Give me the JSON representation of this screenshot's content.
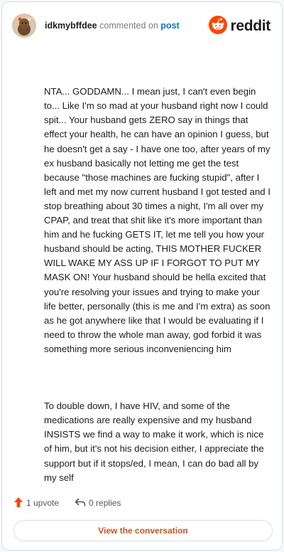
{
  "header": {
    "username": "idkmybffdee",
    "verb": "commented on",
    "post_link": "post",
    "brand": "reddit"
  },
  "comment": {
    "paragraph1": "NTA... GODDAMN... I mean just, I can't even begin to... Like I'm so mad at your husband right now I could spit... Your husband gets ZERO say in things that effect your health, he can have an opinion I guess, but he doesn't get a say - I have one too, after years of my ex husband basically not letting me get the test because \"those machines are fucking stupid\", after I left and met my now current husband I got tested and I stop breathing about 30 times a night, I'm all over my CPAP, and treat that shit like it's more important than him and he fucking GETS IT, let me tell you how your husband should be acting, THIS MOTHER FUCKER WILL WAKE MY ASS UP IF I FORGOT TO PUT MY MASK ON! Your husband should be hella excited that you're resolving your issues and trying to make your life better, personally (this is me and I'm extra) as soon as he got anywhere like that I would be evaluating if I need to throw the whole man away, god forbid it was something more serious inconveniencing him",
    "paragraph2": "To double down, I have HIV, and some of the medications are really expensive and my husband INSISTS we find a way to make it work, which is nice of him, but it's not his decision either, I appreciate the support but if it stops/ed, I mean, I can do bad all by my self"
  },
  "actions": {
    "upvotes": "1 upvote",
    "replies": "0 replies"
  },
  "cta": {
    "label": "View the conversation"
  },
  "colors": {
    "brand_orange": "#ff4500",
    "link_blue": "#0079d3",
    "cta_text": "#c4561f"
  },
  "icons": [
    "avatar",
    "reddit-logo-icon",
    "upvote-arrow-icon",
    "reply-icon"
  ]
}
